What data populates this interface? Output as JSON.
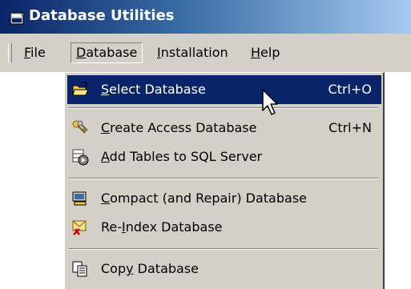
{
  "window": {
    "title": "Database Utilities"
  },
  "menubar": {
    "items": [
      {
        "label": "File",
        "mnemonic": "F"
      },
      {
        "label": "Database",
        "mnemonic": "D"
      },
      {
        "label": "Installation",
        "mnemonic": "I"
      },
      {
        "label": "Help",
        "mnemonic": "H"
      }
    ]
  },
  "dropdown": {
    "items": [
      {
        "label": "Select Database",
        "mnemonic": "S",
        "shortcut": "Ctrl+O",
        "icon": "open-folder-icon",
        "highlighted": true
      },
      {
        "label": "Create Access Database",
        "mnemonic": "C",
        "shortcut": "Ctrl+N",
        "icon": "keys-icon"
      },
      {
        "label": "Add Tables to SQL Server",
        "mnemonic": "A",
        "shortcut": "",
        "icon": "table-play-icon"
      },
      {
        "label": "Compact (and Repair) Database",
        "mnemonic": "C",
        "shortcut": "",
        "icon": "compact-icon"
      },
      {
        "label": "Re-Index Database",
        "mnemonic": "I",
        "shortcut": "",
        "icon": "reindex-icon"
      },
      {
        "label": "Copy Database",
        "mnemonic": "y",
        "shortcut": "",
        "icon": "copy-icon"
      }
    ]
  },
  "colors": {
    "title_gradient_start": "#0a246a",
    "title_gradient_end": "#a6caf0",
    "menu_face": "#d4d0c8",
    "highlight": "#0a246a",
    "client": "#ffffff"
  }
}
